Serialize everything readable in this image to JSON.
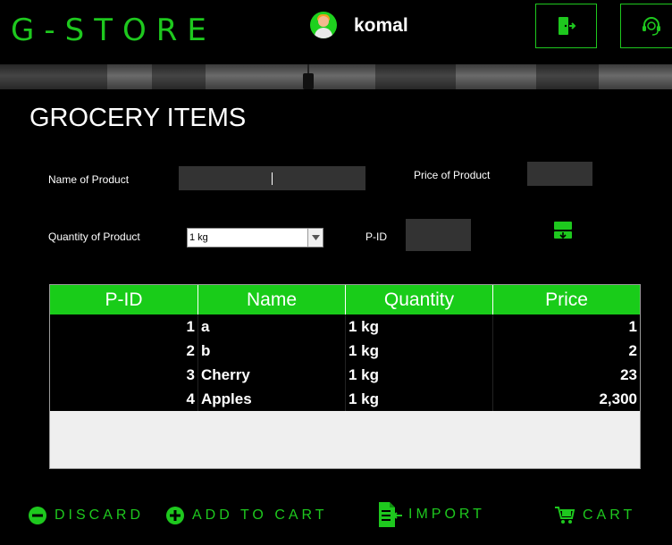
{
  "header": {
    "app_title": "G-STORE",
    "username": "komal",
    "icons": {
      "logout": "exit-door-icon",
      "support": "headset-support-icon",
      "avatar": "user-avatar"
    }
  },
  "page": {
    "title": "GROCERY ITEMS"
  },
  "form": {
    "name_label": "Name of Product",
    "name_value": "",
    "price_label": "Price of Product",
    "price_value": "",
    "quantity_label": "Quantity of Product",
    "quantity_selected": "1 kg",
    "pid_label": "P-ID",
    "pid_value": ""
  },
  "table": {
    "columns": [
      "P-ID",
      "Name",
      "Quantity",
      "Price"
    ],
    "rows": [
      {
        "pid": "1",
        "name": "a",
        "quantity": "1 kg",
        "price": "1"
      },
      {
        "pid": "2",
        "name": "b",
        "quantity": "1 kg",
        "price": "2"
      },
      {
        "pid": "3",
        "name": "Cherry",
        "quantity": "1 kg",
        "price": "23"
      },
      {
        "pid": "4",
        "name": "Apples",
        "quantity": "1 kg",
        "price": "2,300"
      }
    ]
  },
  "actions": {
    "discard": "DISCARD",
    "add_to_cart": "ADD TO CART",
    "import": "IMPORT",
    "cart": "CART"
  },
  "colors": {
    "accent": "#1ec81e",
    "table_header": "#19cc19",
    "background": "#000000"
  }
}
